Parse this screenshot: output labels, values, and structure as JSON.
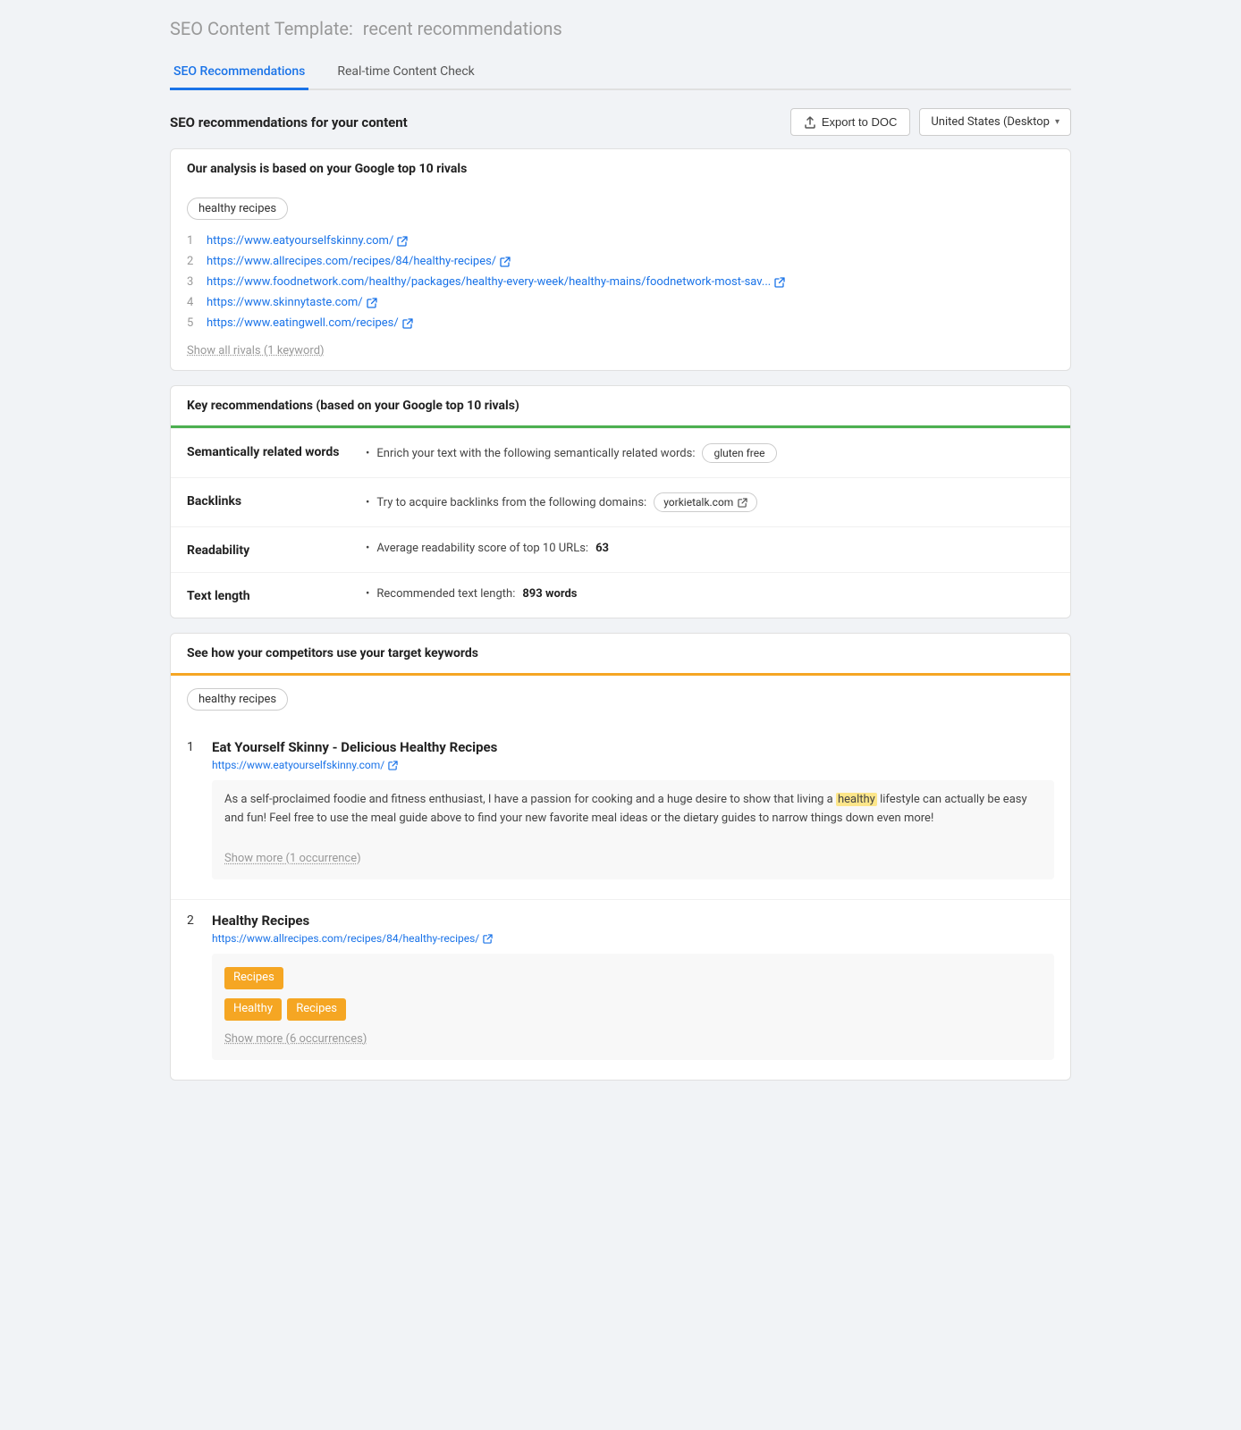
{
  "page": {
    "title_prefix": "SEO Content Template:",
    "title_suffix": "recent recommendations"
  },
  "tabs": [
    {
      "id": "seo-rec",
      "label": "SEO Recommendations",
      "active": true
    },
    {
      "id": "realtime",
      "label": "Real-time Content Check",
      "active": false
    }
  ],
  "toolbar": {
    "section_title": "SEO recommendations for your content",
    "export_label": "Export to DOC",
    "location_label": "United States (Desktop"
  },
  "rivals_card": {
    "header": "Our analysis is based on your Google top 10 rivals",
    "keyword": "healthy recipes",
    "rivals": [
      {
        "num": "1",
        "url": "https://www.eatyourselfskinny.com/"
      },
      {
        "num": "2",
        "url": "https://www.allrecipes.com/recipes/84/healthy-recipes/"
      },
      {
        "num": "3",
        "url": "https://www.foodnetwork.com/healthy/packages/healthy-every-week/healthy-mains/foodnetwork-most-sav..."
      },
      {
        "num": "4",
        "url": "https://www.skinnytaste.com/"
      },
      {
        "num": "5",
        "url": "https://www.eatingwell.com/recipes/"
      }
    ],
    "show_all": "Show all rivals (1 keyword)"
  },
  "key_rec_card": {
    "header": "Key recommendations (based on your Google top 10 rivals)",
    "rows": [
      {
        "label": "Semantically related words",
        "bullet": "Enrich your text with the following semantically related words:",
        "tag": "gluten free"
      },
      {
        "label": "Backlinks",
        "bullet": "Try to acquire backlinks from the following domains:",
        "domain": "yorkietalk.com"
      },
      {
        "label": "Readability",
        "bullet": "Average readability score of top 10 URLs:",
        "value": "63"
      },
      {
        "label": "Text length",
        "bullet": "Recommended text length:",
        "value": "893 words"
      }
    ]
  },
  "competitors_card": {
    "header": "See how your competitors use your target keywords",
    "keyword": "healthy recipes",
    "items": [
      {
        "num": "1",
        "title": "Eat Yourself Skinny - Delicious Healthy Recipes",
        "url": "https://www.eatyourselfskinny.com/",
        "excerpt": "As a self-proclaimed foodie and fitness enthusiast, I have a passion for cooking and a huge desire to show that living a healthy lifestyle can actually be easy and fun! Feel free to use the meal guide above to find your new favorite meal ideas or the dietary guides to narrow things down even more!",
        "highlight_word": "healthy",
        "show_more": "Show more (1 occurrence)",
        "tags": []
      },
      {
        "num": "2",
        "title": "Healthy Recipes",
        "url": "https://www.allrecipes.com/recipes/84/healthy-recipes/",
        "excerpt": "",
        "show_more": "Show more (6 occurrences)",
        "tags": [
          {
            "text": "Recipes",
            "type": "orange"
          },
          {
            "text": "Healthy",
            "type": "orange-outline"
          },
          {
            "text": "Recipes",
            "type": "orange-outline"
          }
        ]
      }
    ]
  },
  "icons": {
    "external_link": "↗",
    "upload": "↑",
    "chevron_down": "▾"
  }
}
